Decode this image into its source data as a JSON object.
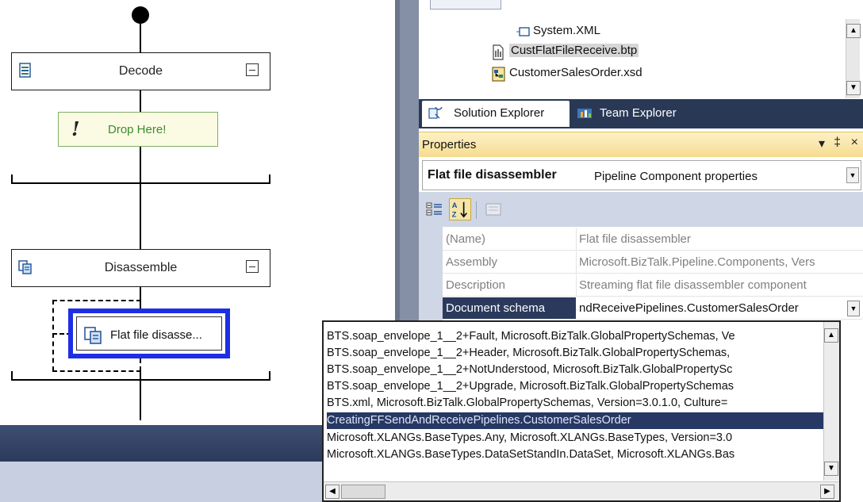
{
  "designer": {
    "stages": [
      {
        "title": "Decode",
        "icon": "decode-stage-icon",
        "collapse": "collapse-icon"
      },
      {
        "title": "Disassemble",
        "icon": "disassemble-stage-icon",
        "collapse": "collapse-icon"
      }
    ],
    "drop_here_label": "Drop Here!",
    "component_label": "Flat file disasse..."
  },
  "solution_explorer": {
    "items": [
      {
        "label": "System.XML",
        "icon": "reference-icon"
      },
      {
        "label": "CustFlatFileReceive.btp",
        "icon": "pipeline-file-icon",
        "selected": true
      },
      {
        "label": "CustomerSalesOrder.xsd",
        "icon": "schema-file-icon"
      }
    ]
  },
  "tabs": {
    "solution_explorer": "Solution Explorer",
    "team_explorer": "Team Explorer"
  },
  "properties": {
    "title": "Properties",
    "header_controls": [
      "▾",
      "‡",
      "×"
    ],
    "object_name": "Flat file disassembler",
    "object_type": "Pipeline Component properties",
    "rows": [
      {
        "name": "(Name)",
        "value": "Flat file disassembler"
      },
      {
        "name": "Assembly",
        "value": "Microsoft.BizTalk.Pipeline.Components, Vers"
      },
      {
        "name": "Description",
        "value": "Streaming flat file disassembler component"
      },
      {
        "name": "Document schema",
        "value": "ndReceivePipelines.CustomerSalesOrder"
      }
    ]
  },
  "schema_dropdown": {
    "items": [
      "BTS.soap_envelope_1__2+Fault, Microsoft.BizTalk.GlobalPropertySchemas, Ve",
      "BTS.soap_envelope_1__2+Header, Microsoft.BizTalk.GlobalPropertySchemas,",
      "BTS.soap_envelope_1__2+NotUnderstood, Microsoft.BizTalk.GlobalPropertySc",
      "BTS.soap_envelope_1__2+Upgrade, Microsoft.BizTalk.GlobalPropertySchemas",
      "BTS.xml, Microsoft.BizTalk.GlobalPropertySchemas, Version=3.0.1.0, Culture=",
      "CreatingFFSendAndReceivePipelines.CustomerSalesOrder",
      "Microsoft.XLANGs.BaseTypes.Any, Microsoft.XLANGs.BaseTypes, Version=3.0",
      "Microsoft.XLANGs.BaseTypes.DataSetStandIn.DataSet, Microsoft.XLANGs.Bas"
    ],
    "selected_index": 5
  },
  "colors": {
    "selection": "#273864",
    "component_border": "#1d2ee3",
    "drop_text": "#3c8b2f",
    "properties_header": "#f6dc8f"
  }
}
